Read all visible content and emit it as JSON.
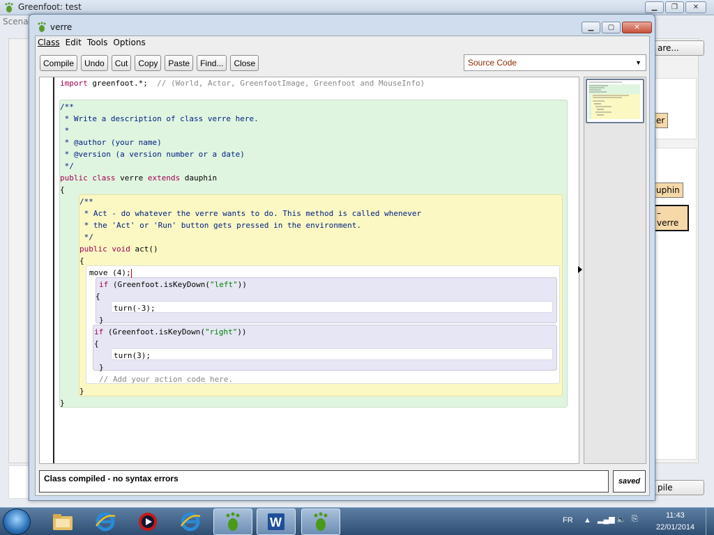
{
  "background_window": {
    "title": "Greenfoot: test",
    "scenario_label": "Scenar",
    "share_button": "are...",
    "compile_button": "pile",
    "class_boxes": [
      "er",
      "uphin",
      "– verre"
    ]
  },
  "editor": {
    "title": "verre",
    "menu": [
      "Class",
      "Edit",
      "Tools",
      "Options"
    ],
    "toolbar": [
      "Compile",
      "Undo",
      "Cut",
      "Copy",
      "Paste",
      "Find...",
      "Close"
    ],
    "view_select": "Source Code",
    "code": {
      "import_kw": "import",
      "import_rest": " greenfoot.*;  ",
      "import_comment": "// (World, Actor, GreenfootImage, Greenfoot and MouseInfo)",
      "class_doc": [
        "/**",
        " * Write a description of class verre here.",
        " *",
        " * @author (your name)",
        " * @version (a version number or a date)",
        " */"
      ],
      "class_decl_kw1": "public class",
      "class_decl_name": " verre ",
      "class_decl_kw2": "extends",
      "class_decl_parent": " dauphin",
      "open_brace": "{",
      "close_brace": "}",
      "method_doc": [
        "/**",
        " * Act - do whatever the verre wants to do. This method is called whenever",
        " * the 'Act' or 'Run' button gets pressed in the environment.",
        " */"
      ],
      "method_kw": "public void",
      "method_name": " act()",
      "move_line": "move (4);",
      "if_kw": "if",
      "if1_pre": " (Greenfoot.isKeyDown(",
      "if1_str": "\"left\"",
      "if_post": "))",
      "turn1": "turn(-3);",
      "if2_str": "\"right\"",
      "turn2": "turn(3);",
      "action_comment": "// Add your action code here."
    },
    "status_message": "Class compiled - no syntax errors",
    "saved_label": "saved"
  },
  "taskbar": {
    "language": "FR",
    "time": "11:43",
    "date": "22/01/2014"
  },
  "colors": {
    "class_scope": "#e0f5e0",
    "method_scope": "#fbf8c4",
    "body_scope": "#ffffff",
    "if_scope": "#e6e6f4",
    "keyword": "#a00050",
    "comment": "#002080"
  }
}
